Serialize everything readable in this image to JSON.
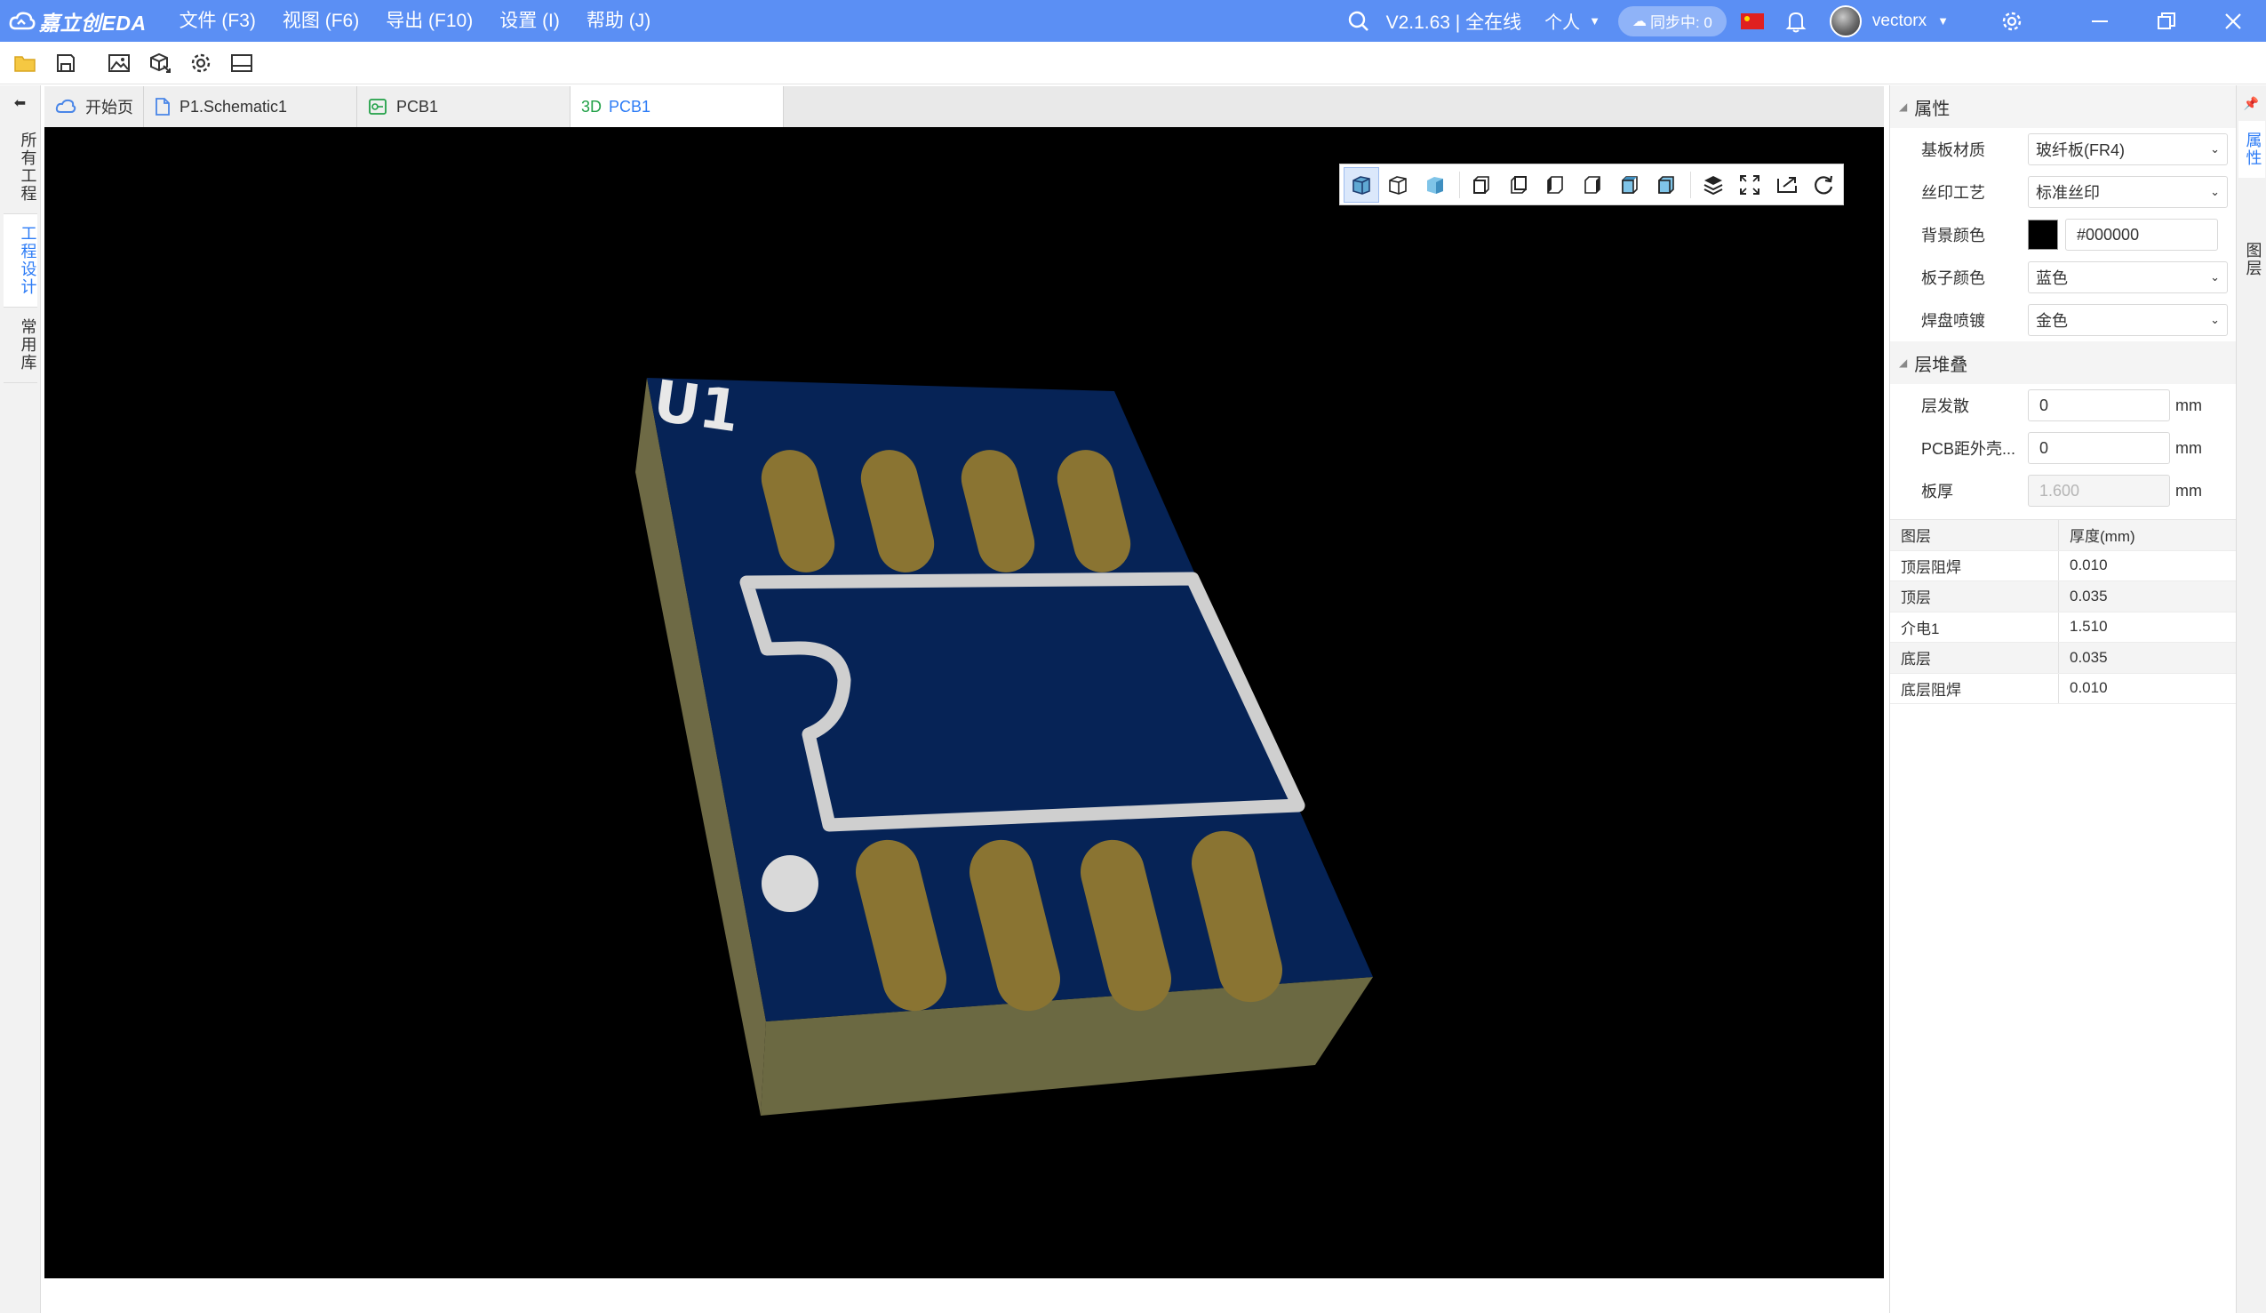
{
  "app": {
    "logo_text": "嘉立创EDA",
    "menu": [
      "文件 (F3)",
      "视图 (F6)",
      "导出 (F10)",
      "设置 (I)",
      "帮助 (J)"
    ],
    "version": "V2.1.63 | 全在线",
    "mode": "个人",
    "sync": "同步中: 0",
    "username": "vectorx",
    "brand_color": "#5b8ff4"
  },
  "sidebar": {
    "items": [
      {
        "label": "所有工程"
      },
      {
        "label": "工程设计"
      },
      {
        "label": "常用库"
      }
    ]
  },
  "tabs": [
    {
      "label": "开始页",
      "icon": "cloud-icon"
    },
    {
      "label": "P1.Schematic1",
      "icon": "document-icon"
    },
    {
      "label": "PCB1",
      "icon": "pcb-icon"
    },
    {
      "label": "PCB1",
      "prefix": "3D"
    }
  ],
  "viewport": {
    "designator": "U1",
    "background_color": "#000000",
    "board_color": "#062356",
    "pad_color": "#8a7432"
  },
  "properties": {
    "title": "属性",
    "rows": [
      {
        "label": "基板材质",
        "value": "玻纤板(FR4)"
      },
      {
        "label": "丝印工艺",
        "value": "标准丝印"
      },
      {
        "label": "背景颜色",
        "value": "#000000"
      },
      {
        "label": "板子颜色",
        "value": "蓝色"
      },
      {
        "label": "焊盘喷镀",
        "value": "金色"
      }
    ]
  },
  "stackup": {
    "title": "层堆叠",
    "rows": [
      {
        "label": "层发散",
        "value": "0",
        "unit": "mm"
      },
      {
        "label": "PCB距外壳...",
        "value": "0",
        "unit": "mm"
      },
      {
        "label": "板厚",
        "value": "1.600",
        "unit": "mm"
      }
    ],
    "table": {
      "headers": [
        "图层",
        "厚度(mm)"
      ],
      "rows": [
        [
          "顶层阻焊",
          "0.010"
        ],
        [
          "顶层",
          "0.035"
        ],
        [
          "介电1",
          "1.510"
        ],
        [
          "底层",
          "0.035"
        ],
        [
          "底层阻焊",
          "0.010"
        ]
      ]
    }
  },
  "right_tabs": [
    "属性",
    "图层"
  ]
}
